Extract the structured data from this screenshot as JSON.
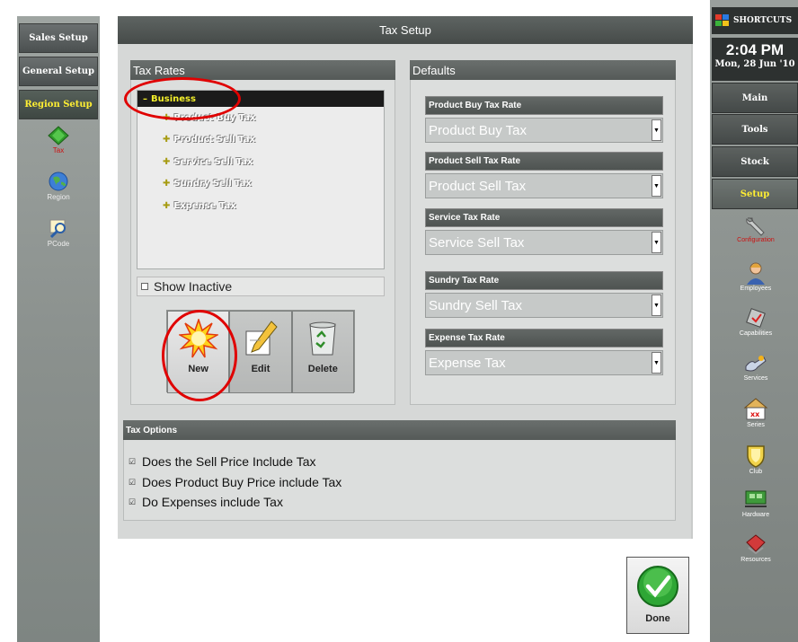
{
  "window": {
    "title": "Tax Setup"
  },
  "left_sidebar": {
    "buttons": [
      {
        "label": "Sales Setup"
      },
      {
        "label": "General Setup"
      },
      {
        "label": "Region Setup"
      }
    ],
    "icons": [
      {
        "label": "Tax",
        "icon": "tax-icon"
      },
      {
        "label": "Region",
        "icon": "globe-icon"
      },
      {
        "label": "PCode",
        "icon": "pcode-icon"
      }
    ]
  },
  "tax_rates": {
    "header": "Tax Rates",
    "root": "Business",
    "root_prefix": "–",
    "items": [
      "Product Buy Tax",
      "Product Sell Tax",
      "Service Sell Tax",
      "Sundry Sell Tax",
      "Expense Tax"
    ],
    "show_inactive_label": "Show Inactive",
    "show_inactive_checked": false,
    "buttons": {
      "new": "New",
      "edit": "Edit",
      "delete": "Delete"
    }
  },
  "defaults": {
    "header": "Defaults",
    "fields": [
      {
        "label": "Product Buy Tax Rate",
        "value": "Product Buy Tax"
      },
      {
        "label": "Product Sell Tax Rate",
        "value": "Product Sell Tax"
      },
      {
        "label": "Service Tax Rate",
        "value": "Service Sell Tax"
      },
      {
        "label": "Sundry Tax Rate",
        "value": "Sundry Sell Tax"
      },
      {
        "label": "Expense Tax Rate",
        "value": "Expense Tax"
      }
    ]
  },
  "tax_options": {
    "header": "Tax Options",
    "options": [
      {
        "label": "Does the Sell Price Include Tax",
        "checked": true
      },
      {
        "label": "Does Product Buy Price include Tax",
        "checked": true
      },
      {
        "label": "Do Expenses include Tax",
        "checked": true
      }
    ]
  },
  "done_label": "Done",
  "right_sidebar": {
    "shortcuts_label": "SHORTCUTS",
    "time": "2:04 PM",
    "date": "Mon, 28 Jun '10",
    "buttons": [
      {
        "label": "Main"
      },
      {
        "label": "Tools"
      },
      {
        "label": "Stock"
      },
      {
        "label": "Setup"
      }
    ],
    "icons": [
      {
        "label": "Configuration",
        "icon": "wrench-icon"
      },
      {
        "label": "Employees",
        "icon": "employee-icon"
      },
      {
        "label": "Capabilities",
        "icon": "capabilities-icon"
      },
      {
        "label": "Services",
        "icon": "services-icon"
      },
      {
        "label": "Series",
        "icon": "series-icon"
      },
      {
        "label": "Club",
        "icon": "club-icon"
      },
      {
        "label": "Hardware",
        "icon": "hardware-icon"
      },
      {
        "label": "Resources",
        "icon": "resources-icon"
      }
    ]
  },
  "colors": {
    "accent_yellow": "#ffee33",
    "annotation_red": "#e00000",
    "done_green": "#2ea635"
  }
}
